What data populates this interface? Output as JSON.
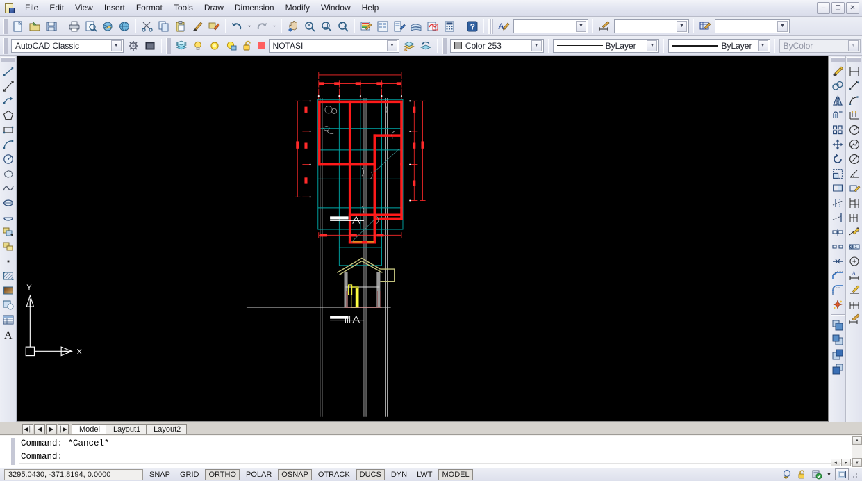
{
  "app": {
    "title": "AutoCAD",
    "logo_icon": "autocad-app-icon"
  },
  "menubar": {
    "items": [
      {
        "label": "File",
        "name": "menu-file"
      },
      {
        "label": "Edit",
        "name": "menu-edit"
      },
      {
        "label": "View",
        "name": "menu-view"
      },
      {
        "label": "Insert",
        "name": "menu-insert"
      },
      {
        "label": "Format",
        "name": "menu-format"
      },
      {
        "label": "Tools",
        "name": "menu-tools"
      },
      {
        "label": "Draw",
        "name": "menu-draw"
      },
      {
        "label": "Dimension",
        "name": "menu-dimension"
      },
      {
        "label": "Modify",
        "name": "menu-modify"
      },
      {
        "label": "Window",
        "name": "menu-window"
      },
      {
        "label": "Help",
        "name": "menu-help"
      }
    ],
    "window_controls": {
      "minimize": "–",
      "restore": "❐",
      "close": "✕"
    }
  },
  "standard_toolbar": {
    "buttons": [
      {
        "icon": "new-file-icon"
      },
      {
        "icon": "open-folder-icon"
      },
      {
        "icon": "save-icon"
      },
      {
        "sep": true
      },
      {
        "icon": "plot-printer-icon"
      },
      {
        "icon": "plot-preview-icon"
      },
      {
        "icon": "publish-icon"
      },
      {
        "icon": "internet-globe-icon"
      },
      {
        "sep": true
      },
      {
        "icon": "cut-scissors-icon"
      },
      {
        "icon": "copy-icon"
      },
      {
        "icon": "paste-icon"
      },
      {
        "icon": "match-properties-brush-icon"
      },
      {
        "icon": "block-editor-icon"
      },
      {
        "sep": true
      },
      {
        "icon": "undo-arrow-icon"
      },
      {
        "icon": "undo-dropdown-icon"
      },
      {
        "icon": "redo-arrow-icon"
      },
      {
        "icon": "redo-dropdown-icon"
      },
      {
        "sep": true
      },
      {
        "icon": "pan-realtime-hand-icon"
      },
      {
        "icon": "zoom-realtime-icon"
      },
      {
        "icon": "zoom-window-icon"
      },
      {
        "icon": "zoom-previous-icon"
      },
      {
        "sep": true
      },
      {
        "icon": "properties-palette-icon"
      },
      {
        "icon": "designcenter-icon"
      },
      {
        "icon": "tool-palettes-icon"
      },
      {
        "icon": "sheet-set-manager-icon"
      },
      {
        "icon": "markup-set-manager-icon"
      },
      {
        "icon": "quick-calc-icon"
      },
      {
        "sep": true
      },
      {
        "icon": "help-question-icon"
      }
    ]
  },
  "styles_toolbar": {
    "text_style_icon": "text-style-icon",
    "text_style_value": "",
    "dim_style_icon": "dimension-style-icon",
    "dim_style_value": "",
    "table_style_icon": "table-style-icon",
    "table_style_value": ""
  },
  "workspaces": {
    "current": "AutoCAD Classic",
    "workspace_settings_icon": "workspace-settings-icon",
    "my_workspace_icon": "my-workspace-icon"
  },
  "layers": {
    "layer_properties_icon": "layer-properties-manager-icon",
    "on_off_icon": "lightbulb-on-icon",
    "freeze_icon": "sun-freeze-icon",
    "freeze_vp_icon": "freeze-viewport-icon",
    "lock_icon": "unlocked-padlock-icon",
    "color_swatch": "#ff5f5f",
    "current_layer": "NOTASI",
    "make_current_icon": "make-object-layer-current-icon",
    "layer_previous_icon": "layer-previous-icon"
  },
  "properties": {
    "color": {
      "label": "Color 253",
      "swatch": "#a8a8a8",
      "icon": "color-control-icon"
    },
    "linetype": {
      "label": "ByLayer",
      "icon": "linetype-control-icon"
    },
    "lineweight": {
      "label": "ByLayer",
      "icon": "lineweight-control-icon"
    },
    "plotstyle": {
      "label": "ByColor",
      "disabled": true,
      "icon": "plot-style-control-icon"
    }
  },
  "draw_toolbar": {
    "title": "Draw",
    "buttons": [
      {
        "icon": "line-icon",
        "name": "draw-line"
      },
      {
        "icon": "construction-line-icon",
        "name": "draw-xline"
      },
      {
        "icon": "polyline-icon",
        "name": "draw-polyline"
      },
      {
        "icon": "polygon-icon",
        "name": "draw-polygon"
      },
      {
        "icon": "rectangle-icon",
        "name": "draw-rectangle"
      },
      {
        "icon": "arc-icon",
        "name": "draw-arc"
      },
      {
        "icon": "circle-icon",
        "name": "draw-circle"
      },
      {
        "icon": "revision-cloud-icon",
        "name": "draw-revcloud"
      },
      {
        "icon": "spline-icon",
        "name": "draw-spline"
      },
      {
        "icon": "ellipse-icon",
        "name": "draw-ellipse"
      },
      {
        "icon": "ellipse-arc-icon",
        "name": "draw-ellipse-arc"
      },
      {
        "icon": "insert-block-icon",
        "name": "insert-block"
      },
      {
        "icon": "make-block-icon",
        "name": "make-block"
      },
      {
        "icon": "point-icon",
        "name": "draw-point"
      },
      {
        "icon": "hatch-icon",
        "name": "draw-hatch"
      },
      {
        "icon": "gradient-icon",
        "name": "draw-gradient"
      },
      {
        "icon": "region-icon",
        "name": "draw-region"
      },
      {
        "icon": "table-icon",
        "name": "draw-table"
      },
      {
        "icon": "multiline-text-icon",
        "name": "draw-mtext"
      }
    ]
  },
  "modify_toolbar": {
    "title": "Modify",
    "buttons": [
      {
        "icon": "erase-icon",
        "name": "modify-erase"
      },
      {
        "icon": "copy-object-icon",
        "name": "modify-copy"
      },
      {
        "icon": "mirror-icon",
        "name": "modify-mirror"
      },
      {
        "icon": "offset-icon",
        "name": "modify-offset"
      },
      {
        "icon": "array-icon",
        "name": "modify-array"
      },
      {
        "icon": "move-icon",
        "name": "modify-move"
      },
      {
        "icon": "rotate-icon",
        "name": "modify-rotate"
      },
      {
        "icon": "scale-icon",
        "name": "modify-scale"
      },
      {
        "icon": "stretch-icon",
        "name": "modify-stretch"
      },
      {
        "icon": "trim-icon",
        "name": "modify-trim"
      },
      {
        "icon": "extend-icon",
        "name": "modify-extend"
      },
      {
        "icon": "break-at-point-icon",
        "name": "modify-break-at-point"
      },
      {
        "icon": "break-icon",
        "name": "modify-break"
      },
      {
        "icon": "join-icon",
        "name": "modify-join"
      },
      {
        "icon": "chamfer-icon",
        "name": "modify-chamfer"
      },
      {
        "icon": "fillet-icon",
        "name": "modify-fillet"
      },
      {
        "icon": "explode-icon",
        "name": "modify-explode"
      }
    ],
    "draworder_buttons": [
      {
        "icon": "bring-to-front-icon",
        "name": "draworder-front"
      },
      {
        "icon": "send-to-back-icon",
        "name": "draworder-back"
      },
      {
        "icon": "bring-above-object-icon",
        "name": "draworder-above"
      },
      {
        "icon": "send-under-object-icon",
        "name": "draworder-under"
      }
    ]
  },
  "dimension_toolbar": {
    "title": "Dimension",
    "buttons": [
      {
        "icon": "linear-dimension-icon",
        "name": "dim-linear"
      },
      {
        "icon": "aligned-dimension-icon",
        "name": "dim-aligned"
      },
      {
        "icon": "arc-length-dimension-icon",
        "name": "dim-arc-length"
      },
      {
        "icon": "ordinate-dimension-icon",
        "name": "dim-ordinate"
      },
      {
        "icon": "radius-dimension-icon",
        "name": "dim-radius"
      },
      {
        "icon": "jogged-dimension-icon",
        "name": "dim-jogged"
      },
      {
        "icon": "diameter-dimension-icon",
        "name": "dim-diameter"
      },
      {
        "icon": "angular-dimension-icon",
        "name": "dim-angular"
      },
      {
        "icon": "quick-dimension-icon",
        "name": "dim-quick"
      },
      {
        "icon": "baseline-dimension-icon",
        "name": "dim-baseline"
      },
      {
        "icon": "continue-dimension-icon",
        "name": "dim-continue"
      },
      {
        "icon": "quick-leader-icon",
        "name": "dim-leader"
      },
      {
        "icon": "tolerance-icon",
        "name": "dim-tolerance"
      },
      {
        "icon": "center-mark-icon",
        "name": "dim-center-mark"
      },
      {
        "icon": "dimension-edit-icon",
        "name": "dim-edit"
      },
      {
        "icon": "dimension-text-edit-icon",
        "name": "dim-text-edit"
      },
      {
        "icon": "dimension-update-icon",
        "name": "dim-update"
      },
      {
        "icon": "dimension-style-control-icon",
        "name": "dim-style"
      }
    ]
  },
  "layout_tabs": {
    "nav": {
      "first": "◀│",
      "prev": "◀",
      "next": "▶",
      "last": "│▶"
    },
    "tabs": [
      {
        "label": "Model",
        "active": true,
        "name": "tab-model"
      },
      {
        "label": "Layout1",
        "active": false,
        "name": "tab-layout1"
      },
      {
        "label": "Layout2",
        "active": false,
        "name": "tab-layout2"
      }
    ]
  },
  "command_window": {
    "lines": [
      "Command: *Cancel*",
      "Command:"
    ],
    "scroll_up_icon": "▲",
    "scroll_down_icon": "▼",
    "scroll_left_icon": "◄",
    "scroll_right_icon": "►"
  },
  "statusbar": {
    "coordinates": "3295.0430, -371.8194, 0.0000",
    "toggles": [
      {
        "label": "SNAP",
        "framed": false,
        "name": "status-snap"
      },
      {
        "label": "GRID",
        "framed": false,
        "name": "status-grid"
      },
      {
        "label": "ORTHO",
        "framed": true,
        "name": "status-ortho"
      },
      {
        "label": "POLAR",
        "framed": false,
        "name": "status-polar"
      },
      {
        "label": "OSNAP",
        "framed": true,
        "name": "status-osnap"
      },
      {
        "label": "OTRACK",
        "framed": false,
        "name": "status-otrack"
      },
      {
        "label": "DUCS",
        "framed": true,
        "name": "status-ducs"
      },
      {
        "label": "DYN",
        "framed": false,
        "name": "status-dyn"
      },
      {
        "label": "LWT",
        "framed": false,
        "name": "status-lwt"
      },
      {
        "label": "MODEL",
        "framed": true,
        "name": "status-model"
      }
    ],
    "tray_icons": [
      {
        "icon": "communication-center-warning-icon"
      },
      {
        "icon": "unlocked-toolbar-padlock-icon"
      },
      {
        "icon": "performance-tuner-ok-icon"
      },
      {
        "icon": "tray-dropdown-icon"
      },
      {
        "icon": "clean-screen-icon"
      }
    ]
  },
  "drawing": {
    "name": "floor-plan-and-section-drawing",
    "ucs_icon": {
      "x_label": "X",
      "y_label": "Y"
    },
    "colors": {
      "walls": "#ff0000",
      "grid": "#00a0a0",
      "dimensions": "#ff2222",
      "section_lines": "#cfcfcf",
      "roof": "#b8b87a",
      "door": "#ffff00",
      "background": "#000000"
    }
  }
}
